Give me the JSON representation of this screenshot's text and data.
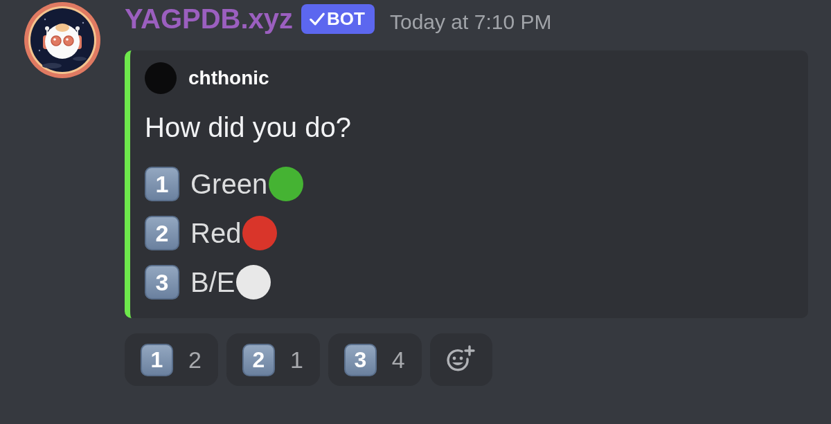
{
  "message": {
    "author": "YAGPDB.xyz",
    "bot_tag": "BOT",
    "timestamp": "Today at 7:10 PM",
    "embed": {
      "author": "chthonic",
      "title": "How did you do?",
      "options": [
        {
          "key": "1",
          "label": "Green",
          "color": "#45b333"
        },
        {
          "key": "2",
          "label": "Red",
          "color": "#d9352a"
        },
        {
          "key": "3",
          "label": "B/E",
          "color": "#e8e8e8"
        }
      ]
    }
  },
  "reactions": [
    {
      "key": "1",
      "count": "2"
    },
    {
      "key": "2",
      "count": "1"
    },
    {
      "key": "3",
      "count": "4"
    }
  ]
}
